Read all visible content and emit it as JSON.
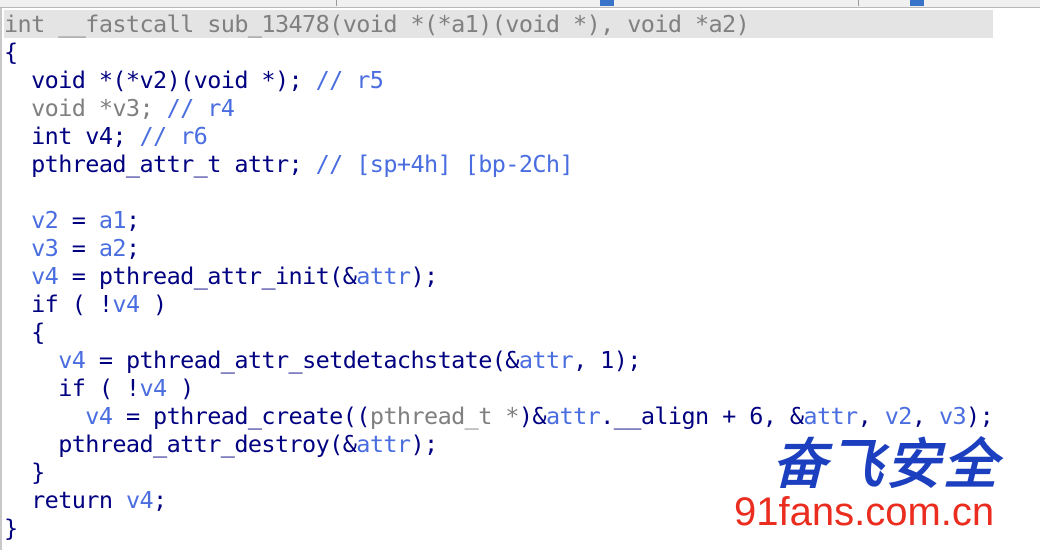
{
  "lines": [
    {
      "tokens": [
        {
          "t": "int __fastcall sub_13478(void *(*a1)(void *), void *a2)",
          "c": "gray"
        }
      ],
      "selected": true
    },
    {
      "tokens": [
        {
          "t": "{",
          "c": "kw"
        }
      ]
    },
    {
      "tokens": [
        {
          "t": "  void *(*v2)(void *); ",
          "c": "kw"
        },
        {
          "t": "// r5",
          "c": "cmt"
        }
      ]
    },
    {
      "tokens": [
        {
          "t": "  void *v3; ",
          "c": "gray"
        },
        {
          "t": "// r4",
          "c": "cmt"
        }
      ]
    },
    {
      "tokens": [
        {
          "t": "  int v4; ",
          "c": "kw"
        },
        {
          "t": "// r6",
          "c": "cmt"
        }
      ]
    },
    {
      "tokens": [
        {
          "t": "  pthread_attr_t attr; ",
          "c": "kw"
        },
        {
          "t": "// [sp+4h] [bp-2Ch]",
          "c": "cmt"
        }
      ]
    },
    {
      "tokens": [
        {
          "t": "",
          "c": "kw"
        }
      ]
    },
    {
      "tokens": [
        {
          "t": "  ",
          "c": "kw"
        },
        {
          "t": "v2",
          "c": "var"
        },
        {
          "t": " = ",
          "c": "kw"
        },
        {
          "t": "a1",
          "c": "var"
        },
        {
          "t": ";",
          "c": "kw"
        }
      ]
    },
    {
      "tokens": [
        {
          "t": "  ",
          "c": "kw"
        },
        {
          "t": "v3",
          "c": "var"
        },
        {
          "t": " = ",
          "c": "kw"
        },
        {
          "t": "a2",
          "c": "var"
        },
        {
          "t": ";",
          "c": "kw"
        }
      ]
    },
    {
      "tokens": [
        {
          "t": "  ",
          "c": "kw"
        },
        {
          "t": "v4",
          "c": "var"
        },
        {
          "t": " = pthread_attr_init(&",
          "c": "kw"
        },
        {
          "t": "attr",
          "c": "var"
        },
        {
          "t": ");",
          "c": "kw"
        }
      ]
    },
    {
      "tokens": [
        {
          "t": "  if ( !",
          "c": "kw"
        },
        {
          "t": "v4",
          "c": "var"
        },
        {
          "t": " )",
          "c": "kw"
        }
      ]
    },
    {
      "tokens": [
        {
          "t": "  {",
          "c": "kw"
        }
      ]
    },
    {
      "tokens": [
        {
          "t": "    ",
          "c": "kw"
        },
        {
          "t": "v4",
          "c": "var"
        },
        {
          "t": " = pthread_attr_setdetachstate(&",
          "c": "kw"
        },
        {
          "t": "attr",
          "c": "var"
        },
        {
          "t": ", 1);",
          "c": "kw"
        }
      ]
    },
    {
      "tokens": [
        {
          "t": "    if ( !",
          "c": "kw"
        },
        {
          "t": "v4",
          "c": "var"
        },
        {
          "t": " )",
          "c": "kw"
        }
      ]
    },
    {
      "tokens": [
        {
          "t": "      ",
          "c": "kw"
        },
        {
          "t": "v4",
          "c": "var"
        },
        {
          "t": " = pthread_create((",
          "c": "kw"
        },
        {
          "t": "pthread_t *",
          "c": "gray"
        },
        {
          "t": ")&",
          "c": "kw"
        },
        {
          "t": "attr",
          "c": "var"
        },
        {
          "t": ".__align + 6, &",
          "c": "kw"
        },
        {
          "t": "attr",
          "c": "var"
        },
        {
          "t": ", ",
          "c": "kw"
        },
        {
          "t": "v2",
          "c": "var"
        },
        {
          "t": ", ",
          "c": "kw"
        },
        {
          "t": "v3",
          "c": "var"
        },
        {
          "t": ");",
          "c": "kw"
        }
      ]
    },
    {
      "tokens": [
        {
          "t": "    pthread_attr_destroy(&",
          "c": "kw"
        },
        {
          "t": "attr",
          "c": "var"
        },
        {
          "t": ");",
          "c": "kw"
        }
      ]
    },
    {
      "tokens": [
        {
          "t": "  }",
          "c": "kw"
        }
      ]
    },
    {
      "tokens": [
        {
          "t": "  return ",
          "c": "kw"
        },
        {
          "t": "v4",
          "c": "var"
        },
        {
          "t": ";",
          "c": "kw"
        }
      ]
    },
    {
      "tokens": [
        {
          "t": "}",
          "c": "kw"
        }
      ]
    }
  ],
  "watermark": {
    "chinese": "奋飞安全",
    "url": "91fans.com.cn"
  },
  "colors": {
    "keyword": "#000080",
    "variable": "#4a6ee0",
    "gray": "#808080",
    "watermark_cn": "#1c3fbf",
    "watermark_url": "#ea2d1f"
  }
}
